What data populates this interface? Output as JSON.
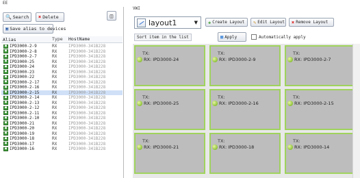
{
  "left": {
    "title": "EE",
    "search_label": "Search",
    "delete_label": "Delete",
    "save_alias_label": "Save alias to devices",
    "columns": {
      "alias": "Alias",
      "type": "Type",
      "host": "HostName"
    },
    "rows": [
      {
        "alias": "IPD3000-2-9",
        "type": "RX",
        "host": "IPD3000-341B228"
      },
      {
        "alias": "IPD3000-2-8",
        "type": "RX",
        "host": "IPD3000-341B228"
      },
      {
        "alias": "IPD3000-2-7",
        "type": "RX",
        "host": "IPD3000-341B228"
      },
      {
        "alias": "IPD3000-25",
        "type": "RX",
        "host": "IPD3000-341B228"
      },
      {
        "alias": "IPD3000-24",
        "type": "RX",
        "host": "IPD3000-341B228"
      },
      {
        "alias": "IPD3000-23",
        "type": "RX",
        "host": "IPD3000-341B228"
      },
      {
        "alias": "IPD3000-22",
        "type": "RX",
        "host": "IPD3000-341B228"
      },
      {
        "alias": "IPD3000-2-17",
        "type": "RX",
        "host": "IPD3000-341B228"
      },
      {
        "alias": "IPD3000-2-16",
        "type": "RX",
        "host": "IPD3000-341B228"
      },
      {
        "alias": "IPD3000-2-15",
        "type": "RX",
        "host": "IPD3000-341B228",
        "selected": true
      },
      {
        "alias": "IPD3000-2-14",
        "type": "RX",
        "host": "IPD3000-341B228"
      },
      {
        "alias": "IPD3000-2-13",
        "type": "RX",
        "host": "IPD3000-341B228"
      },
      {
        "alias": "IPD3000-2-12",
        "type": "RX",
        "host": "IPD3000-341B228"
      },
      {
        "alias": "IPD3000-2-11",
        "type": "RX",
        "host": "IPD3000-341B228"
      },
      {
        "alias": "IPD3000-2-10",
        "type": "RX",
        "host": "IPD3000-341B228"
      },
      {
        "alias": "IPD3000-21",
        "type": "RX",
        "host": "IPD3000-341B228"
      },
      {
        "alias": "IPD3000-20",
        "type": "RX",
        "host": "IPD3000-341B228"
      },
      {
        "alias": "IPD3000-19",
        "type": "RX",
        "host": "IPD3000-341B228"
      },
      {
        "alias": "IPD3000-18",
        "type": "RX",
        "host": "IPD3000-341B228"
      },
      {
        "alias": "IPD3000-17",
        "type": "RX",
        "host": "IPD3000-341B228"
      },
      {
        "alias": "IPD3000-16",
        "type": "RX",
        "host": "IPD3000-341B228"
      }
    ]
  },
  "right": {
    "title": "VWI",
    "layout_value": "layout1",
    "create_label": "Create Layout",
    "edit_label": "Edit Layout",
    "remove_label": "Remove Layout",
    "sort_label": "Sort item in the list",
    "apply_label": "Apply",
    "auto_apply_label": "Automatically apply",
    "auto_apply_checked": false,
    "tiles": [
      {
        "tx": "TX:",
        "rx": "RX: IPD3000-24"
      },
      {
        "tx": "TX:",
        "rx": "RX: IPD3000-2-9"
      },
      {
        "tx": "TX:",
        "rx": "RX: IPD3000-2-7"
      },
      {
        "tx": "TX:",
        "rx": "RX: IPD3000-25"
      },
      {
        "tx": "TX:",
        "rx": "RX: IPD3000-2-16"
      },
      {
        "tx": "TX:",
        "rx": "RX: IPD3000-2-15"
      },
      {
        "tx": "TX:",
        "rx": "RX: IPD3000-21"
      },
      {
        "tx": "TX:",
        "rx": "RX: IPD3000-18"
      },
      {
        "tx": "TX:",
        "rx": "RX: IPD3000-14"
      }
    ]
  },
  "colors": {
    "tile_border": "#9fd35c",
    "tile_fill": "#bdbdbd",
    "selected_row": "#cfe0f7",
    "rx_badge": "#3e9b3a"
  }
}
